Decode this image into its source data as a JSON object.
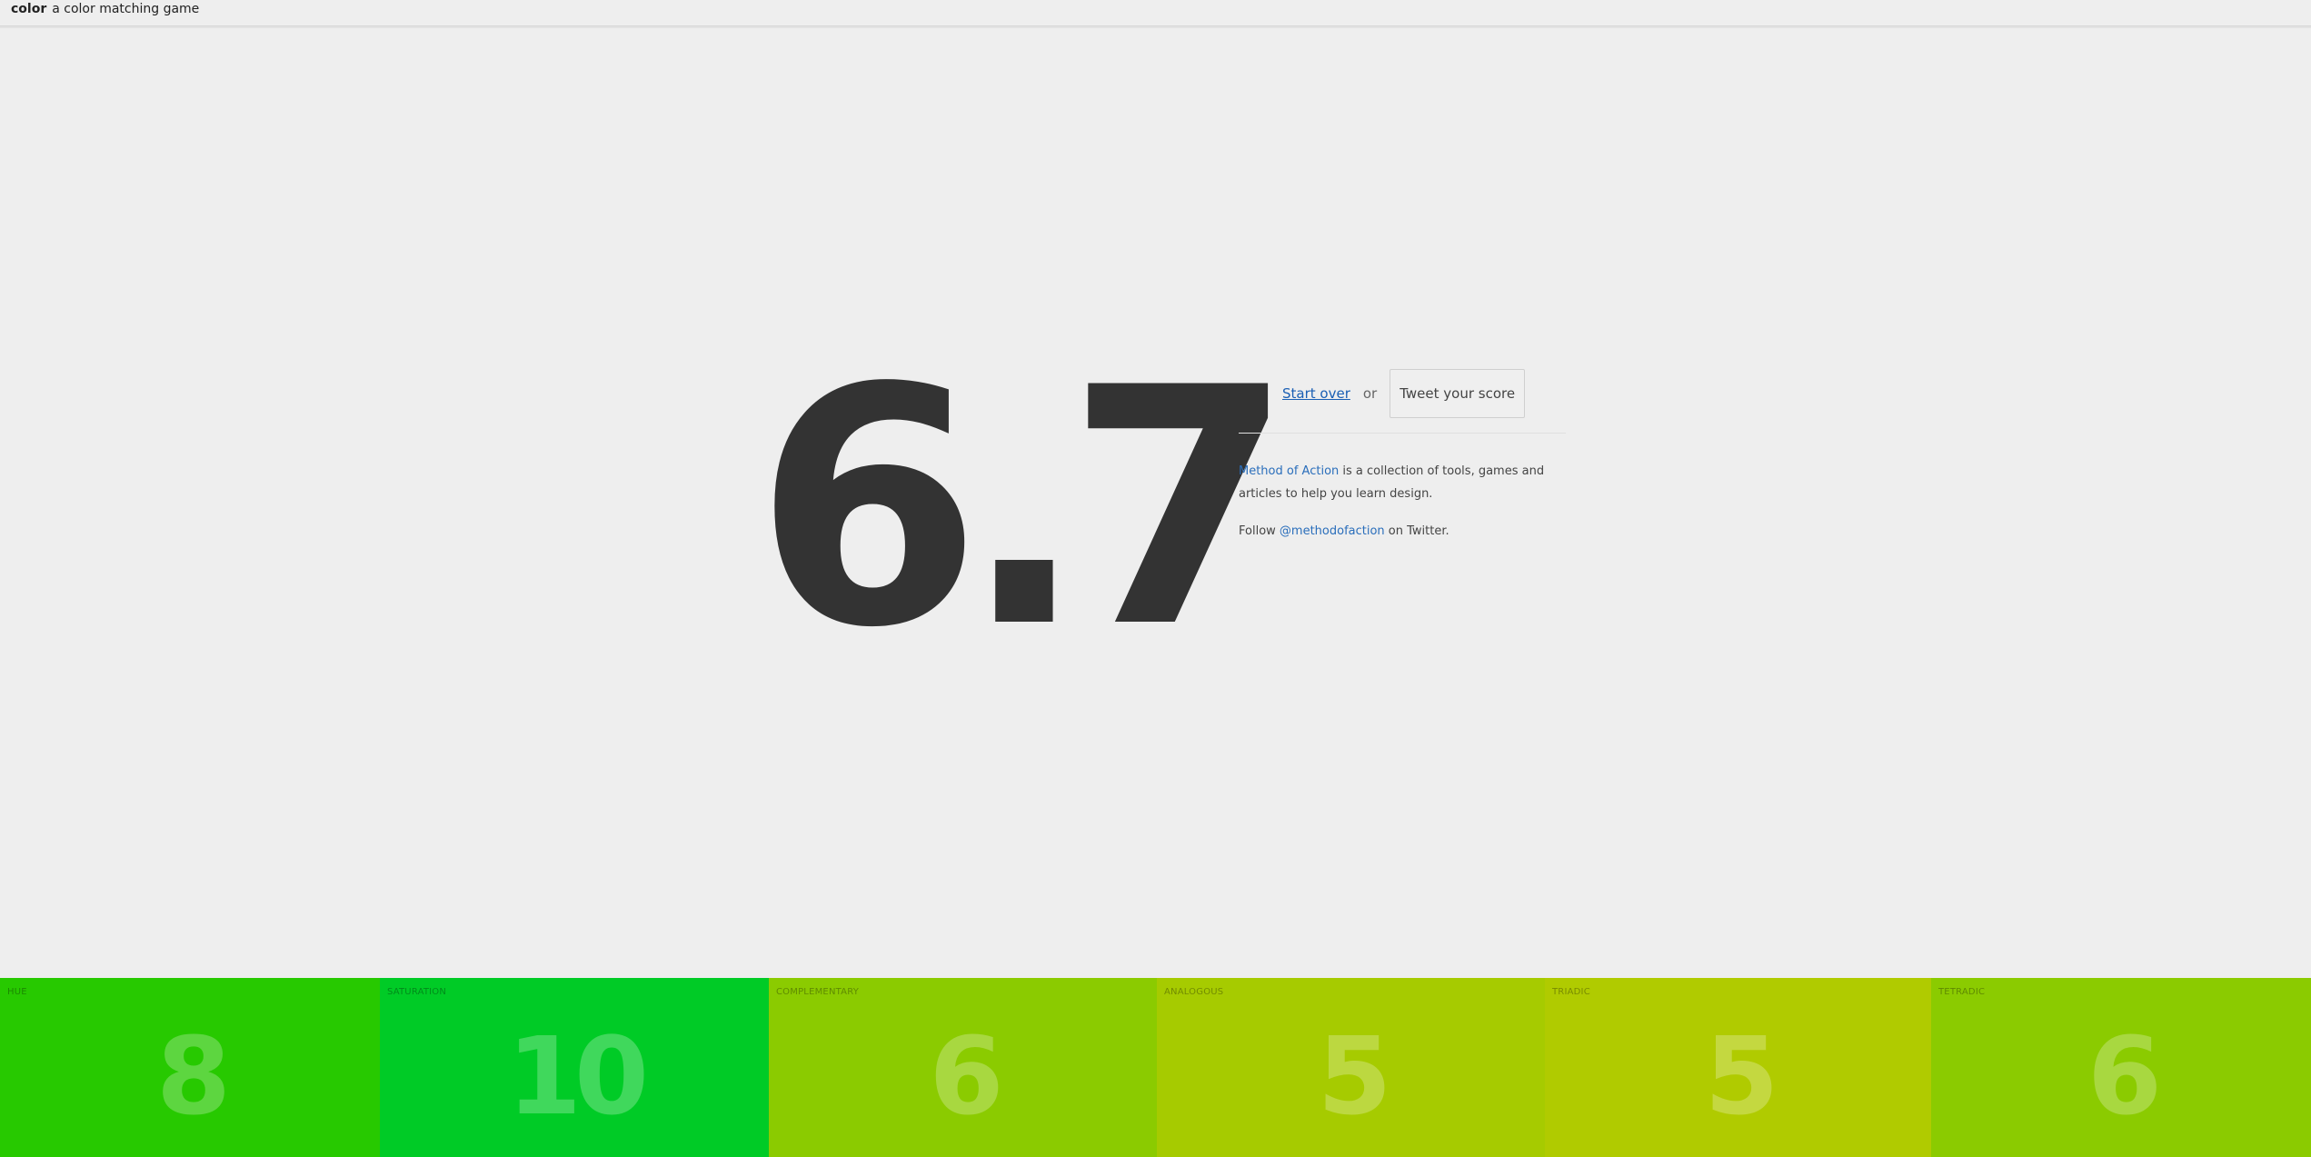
{
  "header": {
    "app_name": "color",
    "tagline": "a color matching game"
  },
  "result": {
    "score": "6.7"
  },
  "actions": {
    "start_over_label": "Start over",
    "or_text": "or",
    "tweet_label": "Tweet your score"
  },
  "about": {
    "link_text": "Method of Action",
    "description": " is a collection of tools, games and articles to help you learn design.",
    "follow_prefix": "Follow ",
    "twitter_handle": "@methodofaction",
    "follow_suffix": " on Twitter."
  },
  "tiles": [
    {
      "label": "HUE",
      "value": "8",
      "color": "#27c900"
    },
    {
      "label": "SATURATION",
      "value": "10",
      "color": "#00cb26"
    },
    {
      "label": "COMPLEMENTARY",
      "value": "6",
      "color": "#8bcb00"
    },
    {
      "label": "ANALOGOUS",
      "value": "5",
      "color": "#a6cb00"
    },
    {
      "label": "TRIADIC",
      "value": "5",
      "color": "#b0cb00"
    },
    {
      "label": "TETRADIC",
      "value": "6",
      "color": "#8bcb00"
    }
  ]
}
